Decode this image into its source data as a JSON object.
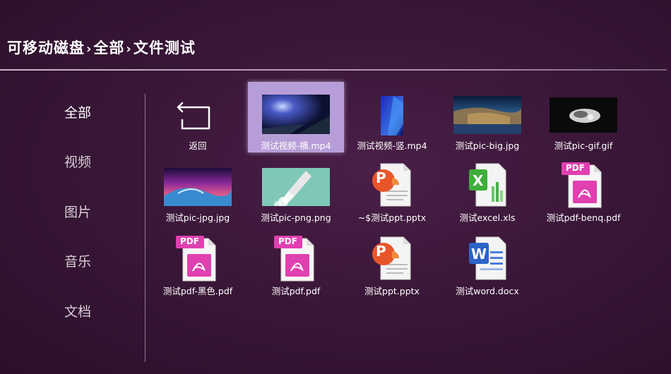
{
  "breadcrumb": {
    "part1": "可移动磁盘",
    "sep": "›",
    "part2": "全部",
    "part3": "文件测试"
  },
  "sidebar": {
    "items": [
      {
        "label": "全部",
        "active": true
      },
      {
        "label": "视频",
        "active": false
      },
      {
        "label": "图片",
        "active": false
      },
      {
        "label": "音乐",
        "active": false
      },
      {
        "label": "文档",
        "active": false
      }
    ]
  },
  "files": [
    {
      "label": "返回",
      "kind": "back-icon"
    },
    {
      "label": "测试视频-横.mp4",
      "kind": "video-thumbnail",
      "selected": true
    },
    {
      "label": "测试视频-竖.mp4",
      "kind": "video-thumbnail"
    },
    {
      "label": "测试pic-big.jpg",
      "kind": "image-thumbnail"
    },
    {
      "label": "测试pic-gif.gif",
      "kind": "image-thumbnail"
    },
    {
      "label": "测试pic-jpg.jpg",
      "kind": "image-thumbnail"
    },
    {
      "label": "测试pic-png.png",
      "kind": "image-thumbnail"
    },
    {
      "label": "~$测试ppt.pptx",
      "kind": "ppt-icon"
    },
    {
      "label": "测试excel.xls",
      "kind": "excel-icon"
    },
    {
      "label": "测试pdf-benq.pdf",
      "kind": "pdf-icon"
    },
    {
      "label": "测试pdf-黑色.pdf",
      "kind": "pdf-icon"
    },
    {
      "label": "测试pdf.pdf",
      "kind": "pdf-icon"
    },
    {
      "label": "测试ppt.pptx",
      "kind": "ppt-icon"
    },
    {
      "label": "测试word.docx",
      "kind": "word-icon"
    }
  ],
  "icon_text": {
    "pdf": "PDF",
    "ppt": "P",
    "excel": "X",
    "word": "W"
  },
  "colors": {
    "background": "#3a1738",
    "selected_tile": "#b89ed8",
    "pdf_accent": "#e040b0",
    "ppt_accent": "#e8552a",
    "excel_accent": "#3fae3a",
    "word_accent": "#2b64c8"
  }
}
